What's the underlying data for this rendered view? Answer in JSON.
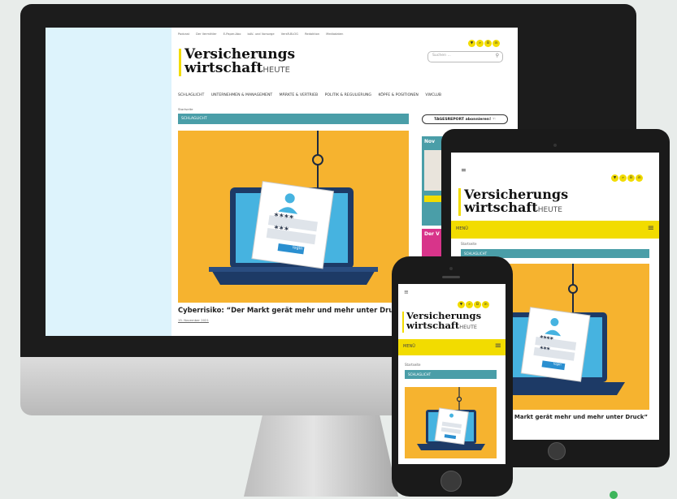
{
  "desktop": {
    "top_nav": [
      "Podcast",
      "Der Vermittler",
      "E-Paper-Abo",
      "bAV- und Vorsorge",
      "VersR-BLOG",
      "Redaktion",
      "Mediadaten"
    ],
    "social": [
      "▼",
      "»",
      "B",
      "in"
    ],
    "logo_line1": "Versicherungs",
    "logo_line2": "wirtschaft",
    "logo_heute": "HEUTE",
    "search_placeholder": "Suchen ...",
    "main_nav": [
      "SCHLAGLICHT",
      "UNTERNEHMEN & MANAGEMENT",
      "MÄRKTE & VERTRIEB",
      "POLITIK & REGULIERUNG",
      "KÖPFE & POSITIONEN",
      "VWCLUB"
    ],
    "breadcrumb": "Startseite",
    "section_bar": "SCHLAGLICHT",
    "tagesreport_button": "TAGESREPORT abonnieren!",
    "login_stars_1": "****",
    "login_stars_2": "***",
    "login_button": "login",
    "headline": "Cyberrisiko: “Der Markt gerät mehr und mehr unter Druck”",
    "date": "15. November 2021",
    "sidebar_nov": "Nov",
    "sidebar_der": "Der V"
  },
  "tablet": {
    "logo_line1": "Versicherungs",
    "logo_line2": "wirtschaft",
    "logo_heute": "HEUTE",
    "menu_label": "MENÜ",
    "breadcrumb": "Startseite",
    "section_bar": "SCHLAGLICHT",
    "headline_partial": "r Markt gerät mehr und mehr unter Druck”",
    "login_stars_1": "****",
    "login_stars_2": "***",
    "login_button": "login"
  },
  "phone": {
    "logo_line1": "Versicherungs",
    "logo_line2": "wirtschaft",
    "logo_heute": "HEUTE",
    "menu_label": "MENÜ",
    "breadcrumb": "Startseite",
    "section_bar": "SCHLAGLICHT"
  },
  "colors": {
    "brand_yellow": "#f2dc00",
    "teal": "#4a9ea8",
    "illustration_orange": "#f6b32f"
  }
}
